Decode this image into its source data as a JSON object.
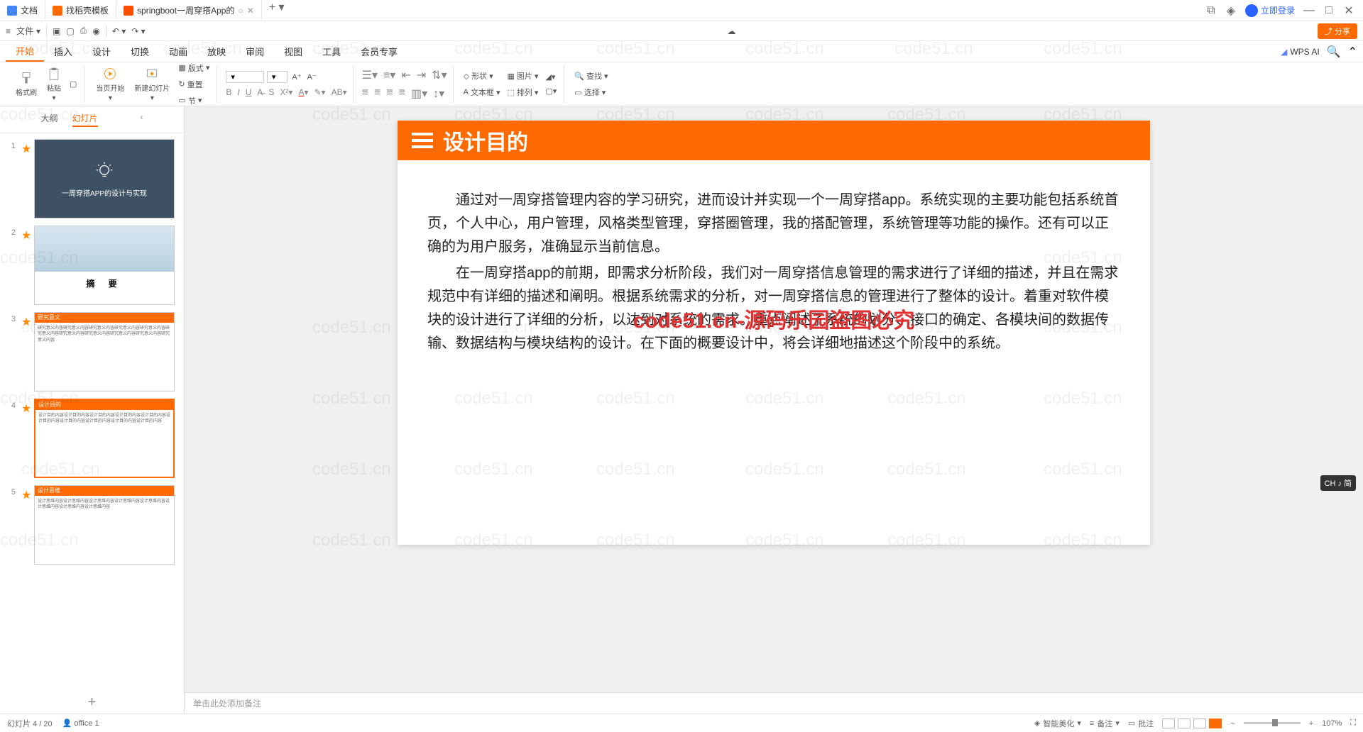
{
  "titlebar": {
    "tabs": [
      {
        "icon_bg": "#4285f4",
        "label": "文档"
      },
      {
        "icon_bg": "#ff6a00",
        "label": "找稻壳模板"
      },
      {
        "icon_bg": "#ff4d00",
        "label": "springboot一周穿搭App的"
      }
    ],
    "login": "立即登录"
  },
  "quickbar": {
    "file": "文件"
  },
  "menu": {
    "items": [
      "开始",
      "插入",
      "设计",
      "切换",
      "动画",
      "放映",
      "审阅",
      "视图",
      "工具",
      "会员专享"
    ],
    "wps_ai": "WPS AI"
  },
  "ribbon": {
    "format_painter": "格式刷",
    "paste": "粘贴",
    "from_current": "当页开始",
    "new_slide": "新建幻灯片",
    "layout": "版式",
    "reset": "重置",
    "section": "节",
    "shape": "形状",
    "image": "图片",
    "textbox": "文本框",
    "arrange": "排列",
    "find": "查找",
    "select": "选择"
  },
  "sidebar": {
    "outline": "大纲",
    "slides": "幻灯片",
    "thumb1_title": "一周穿搭APP的设计与实现",
    "thumb2_title": "摘    要",
    "thumb3_header": "研究意义",
    "thumb4_header": "设计目的",
    "thumb5_header": "设计思维"
  },
  "slide": {
    "title": "设计目的",
    "p1": "通过对一周穿搭管理内容的学习研究，进而设计并实现一个一周穿搭app。系统实现的主要功能包括系统首页，个人中心，用户管理，风格类型管理，穿搭圈管理，我的搭配管理，系统管理等功能的操作。还有可以正确的为用户服务，准确显示当前信息。",
    "p2": "在一周穿搭app的前期，即需求分析阶段，我们对一周穿搭信息管理的需求进行了详细的描述，并且在需求规范中有详细的描述和阐明。根据系统需求的分析，对一周穿搭信息的管理进行了整体的设计。着重对软件模块的设计进行了详细的分析，以达到对系统的需求。重点阐述了系统的划分、接口的确定、各模块间的数据传输、数据结构与模块结构的设计。在下面的概要设计中，将会详细地描述这个阶段中的系统。",
    "watermark": "code51.cn-源码乐园盗图必究"
  },
  "notes": {
    "placeholder": "单击此处添加备注"
  },
  "statusbar": {
    "slide_count": "幻灯片 4 / 20",
    "office": "office 1",
    "beautify": "智能美化",
    "notes": "备注",
    "comment": "批注",
    "zoom": "107%"
  },
  "ime": "CH ♪ 简",
  "bg_wm": "code51.cn"
}
